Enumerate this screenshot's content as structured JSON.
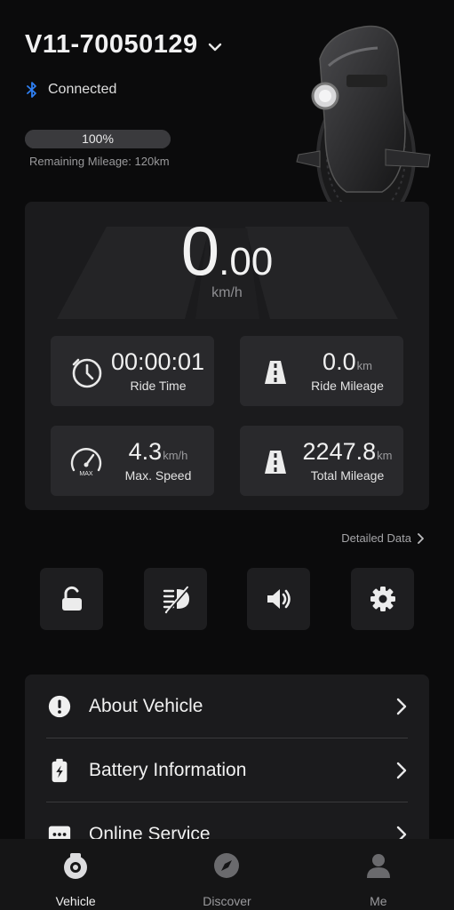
{
  "device": {
    "name": "V11-70050129"
  },
  "connection": {
    "status": "Connected",
    "color": "#2f7ff2"
  },
  "battery": {
    "percent_label": "100%",
    "level": 1.0,
    "remaining": "Remaining Mileage: 120km"
  },
  "speed": {
    "integer": "0",
    "decimal": ".00",
    "unit": "km/h"
  },
  "stats": {
    "ride_time": {
      "value": "00:00:01",
      "unit": "",
      "label": "Ride Time",
      "icon": "clock-icon"
    },
    "ride_mileage": {
      "value": "0.0",
      "unit": "km",
      "label": "Ride Mileage",
      "icon": "road-icon"
    },
    "max_speed": {
      "value": "4.3",
      "unit": "km/h",
      "label": "Max. Speed",
      "icon": "speedometer-icon"
    },
    "total_mileage": {
      "value": "2247.8",
      "unit": "km",
      "label": "Total Mileage",
      "icon": "road-icon"
    }
  },
  "speedometer_badge": "MAX",
  "detailed_data": {
    "label": "Detailed Data"
  },
  "quick_actions": [
    "unlock-icon",
    "headlight-off-icon",
    "volume-icon",
    "gear-icon"
  ],
  "menu": [
    {
      "label": "About Vehicle",
      "icon": "info-icon"
    },
    {
      "label": "Battery Information",
      "icon": "battery-icon"
    },
    {
      "label": "Online Service",
      "icon": "message-icon"
    }
  ],
  "tabs": [
    {
      "label": "Vehicle",
      "icon": "vehicle-icon",
      "active": true
    },
    {
      "label": "Discover",
      "icon": "compass-icon",
      "active": false
    },
    {
      "label": "Me",
      "icon": "person-icon",
      "active": false
    }
  ]
}
